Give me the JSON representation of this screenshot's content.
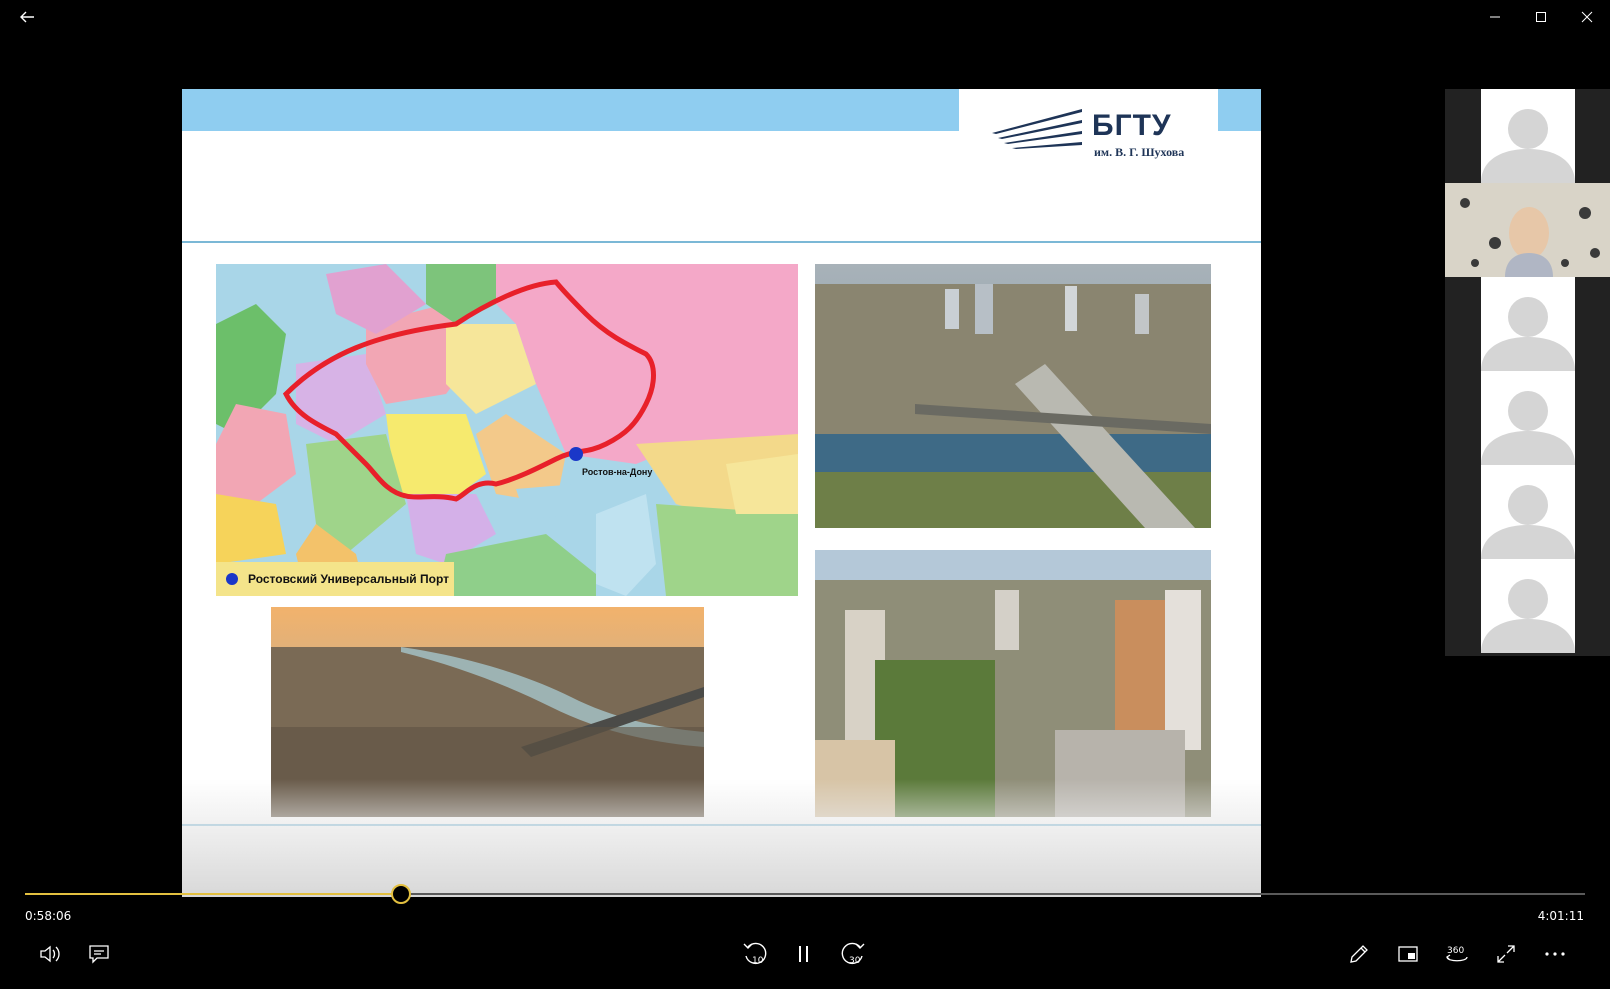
{
  "window": {
    "back_icon": "back-arrow-icon",
    "minimize_icon": "minimize-icon",
    "maximize_icon": "maximize-icon",
    "close_icon": "close-icon"
  },
  "slide": {
    "logo_title": "БГТУ",
    "logo_subtitle": "им. В. Г. Шухова",
    "map": {
      "legend": "Ростовский Универсальный Порт",
      "city_label": "Ростов-на-Дону",
      "route_color": "#e8202a",
      "marker_color": "#1a37c8"
    },
    "accent_color": "#8fcdf0"
  },
  "participants": {
    "count": 6,
    "active_camera_index": 1
  },
  "player": {
    "current_time": "0:58:06",
    "total_time": "4:01:11",
    "progress": 0.2413,
    "accent_color": "#e3c040",
    "skip_back_label": "10",
    "skip_forward_label": "30",
    "vr_label": "360"
  }
}
